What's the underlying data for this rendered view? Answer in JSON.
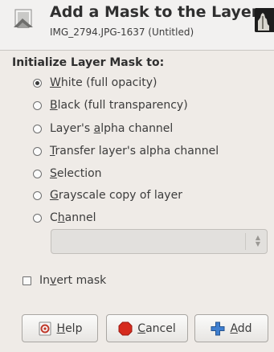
{
  "header": {
    "title": "Add a Mask to the Layer",
    "subtitle": "IMG_2794.JPG-1637 (Untitled)"
  },
  "section_label": "Initialize Layer Mask to:",
  "options": [
    {
      "mnemonic": "W",
      "rest": "hite (full opacity)",
      "before": "",
      "checked": true
    },
    {
      "mnemonic": "B",
      "rest": "lack (full transparency)",
      "before": "",
      "checked": false
    },
    {
      "before": "Layer's ",
      "mnemonic": "a",
      "rest": "lpha channel",
      "checked": false
    },
    {
      "before": "",
      "mnemonic": "T",
      "rest": "ransfer layer's alpha channel",
      "checked": false
    },
    {
      "before": "",
      "mnemonic": "S",
      "rest": "election",
      "checked": false
    },
    {
      "before": "",
      "mnemonic": "G",
      "rest": "rayscale copy of layer",
      "checked": false
    },
    {
      "before": "C",
      "mnemonic": "h",
      "rest": "annel",
      "checked": false
    }
  ],
  "channel_combo": {
    "value": ""
  },
  "invert": {
    "before": "In",
    "mnemonic": "v",
    "rest": "ert mask",
    "checked": false
  },
  "buttons": {
    "help": {
      "mnemonic": "H",
      "rest": "elp"
    },
    "cancel": {
      "mnemonic": "C",
      "rest": "ancel"
    },
    "add": {
      "mnemonic": "A",
      "rest": "dd"
    }
  }
}
